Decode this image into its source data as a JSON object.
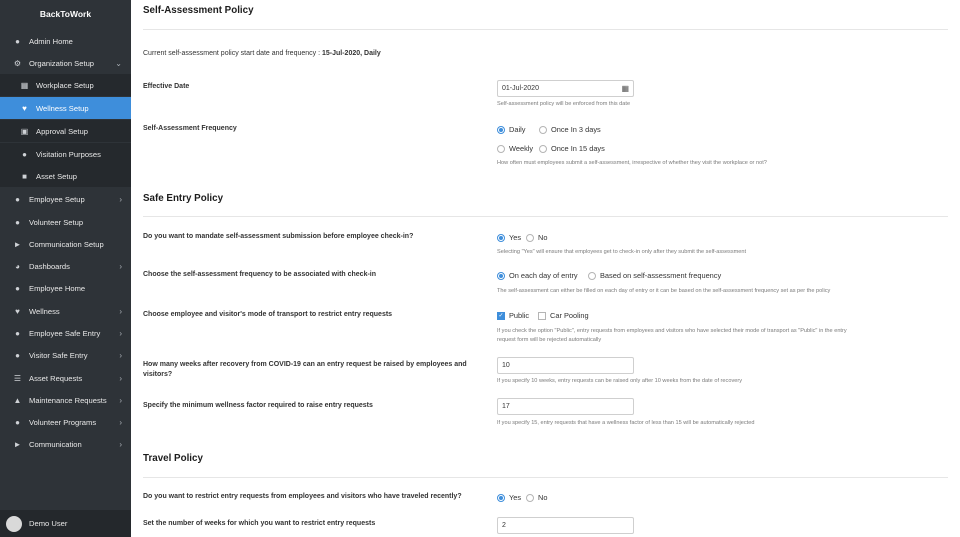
{
  "sidebar": {
    "brand": "BackToWork",
    "items": [
      {
        "label": "Admin Home",
        "icon": "user-icon"
      },
      {
        "label": "Organization Setup",
        "icon": "gear-icon"
      },
      {
        "label": "Workplace Setup",
        "icon": "building-icon"
      },
      {
        "label": "Wellness Setup",
        "icon": "heart-icon"
      },
      {
        "label": "Approval Setup",
        "icon": "clipboard-icon"
      },
      {
        "label": "Visitation Purposes",
        "icon": "user-icon"
      },
      {
        "label": "Asset Setup",
        "icon": "box-icon"
      },
      {
        "label": "Employee Setup",
        "icon": "users-icon"
      },
      {
        "label": "Volunteer Setup",
        "icon": "user-plus-icon"
      },
      {
        "label": "Communication Setup",
        "icon": "megaphone-icon"
      },
      {
        "label": "Dashboards",
        "icon": "pie-chart-icon"
      },
      {
        "label": "Employee Home",
        "icon": "user-icon"
      },
      {
        "label": "Wellness",
        "icon": "heart-icon"
      },
      {
        "label": "Employee Safe Entry",
        "icon": "user-icon"
      },
      {
        "label": "Visitor Safe Entry",
        "icon": "user-icon"
      },
      {
        "label": "Asset Requests",
        "icon": "list-icon"
      },
      {
        "label": "Maintenance Requests",
        "icon": "wrench-icon"
      },
      {
        "label": "Volunteer Programs",
        "icon": "user-plus-icon"
      },
      {
        "label": "Communication",
        "icon": "megaphone-icon"
      }
    ],
    "user": "Demo User",
    "accent": "#3e8edb"
  },
  "self_assessment": {
    "title": "Self-Assessment Policy",
    "current_prefix": "Current self-assessment policy start date and frequency : ",
    "current_value": "15-Jul-2020, Daily",
    "effective_date_label": "Effective Date",
    "effective_date_value": "01-Jul-2020",
    "effective_date_hint": "Self-assessment policy will be enforced from this date",
    "frequency_label": "Self-Assessment Frequency",
    "freq_daily": "Daily",
    "freq_3days": "Once In 3 days",
    "freq_weekly": "Weekly",
    "freq_15days": "Once In 15 days",
    "frequency_hint": "How often must employees submit a self-assessment, irrespective of whether they visit the workplace or not?"
  },
  "safe_entry": {
    "title": "Safe Entry Policy",
    "q1": "Do you want to mandate self-assessment submission before employee check-in?",
    "q1_yes": "Yes",
    "q1_no": "No",
    "q1_hint": "Selecting \"Yes\" will ensure that employees get to check-in only after they submit the self-assessment",
    "q2": "Choose the self-assessment frequency to be associated with check-in",
    "q2_opt1": "On each day of entry",
    "q2_opt2": "Based on self-assessment frequency",
    "q2_hint": "The self-assessment can either be filled on each day of entry or it can be based on the self-assessment frequency set as per the policy",
    "q3": "Choose employee and visitor's mode of transport to restrict entry requests",
    "q3_public": "Public",
    "q3_car": "Car Pooling",
    "q3_hint_1": "If you check the option \"Public\", entry requests from employees and visitors who have selected their mode of transport as \"Public\" in the entry",
    "q3_hint_2": "request form will be rejected automatically",
    "q4_1": "How many weeks after recovery from COVID-19 can an entry request be raised by employees and",
    "q4_2": "visitors?",
    "q4_value": "10",
    "q4_hint": "If you specify 10 weeks, entry requests can be raised only after 10 weeks from the date of recovery",
    "q5": "Specify the minimum wellness factor required to raise entry requests",
    "q5_value": "17",
    "q5_hint": "If you specify 15, entry requests that have a wellness factor of less than 15 will be automatically rejected"
  },
  "travel": {
    "title": "Travel Policy",
    "q1": "Do you want to restrict entry requests from employees and visitors who have traveled recently?",
    "q1_yes": "Yes",
    "q1_no": "No",
    "q2": "Set the number of weeks for which you want to restrict entry requests",
    "q2_value": "2"
  }
}
